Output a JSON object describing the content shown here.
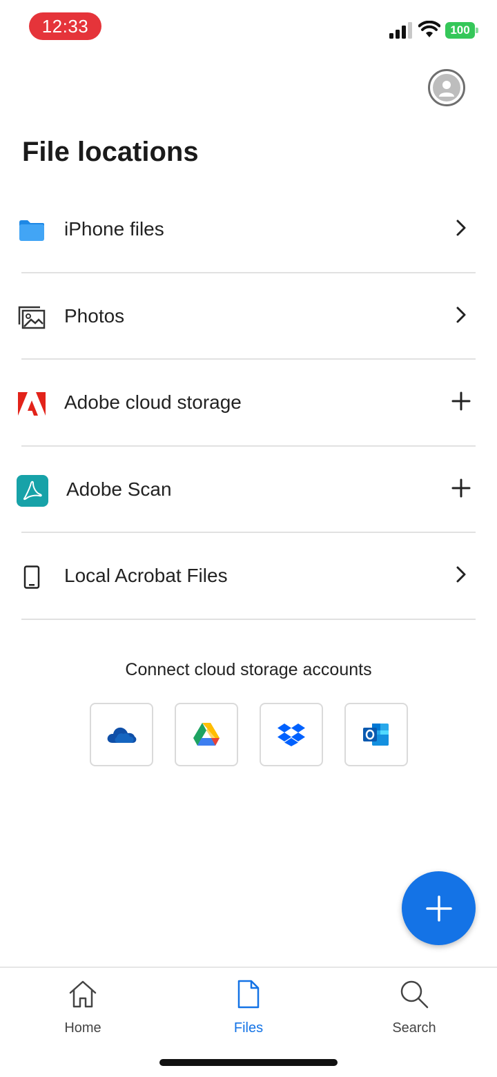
{
  "status_bar": {
    "time": "12:33",
    "battery": "100"
  },
  "page": {
    "title": "File locations"
  },
  "locations": [
    {
      "label": "iPhone files",
      "icon": "folder-icon",
      "action": "chevron-right-icon"
    },
    {
      "label": "Photos",
      "icon": "photos-icon",
      "action": "chevron-right-icon"
    },
    {
      "label": "Adobe cloud storage",
      "icon": "adobe-logo-icon",
      "action": "plus-icon"
    },
    {
      "label": "Adobe Scan",
      "icon": "adobe-scan-icon",
      "action": "plus-icon"
    },
    {
      "label": "Local Acrobat Files",
      "icon": "phone-icon",
      "action": "chevron-right-icon"
    }
  ],
  "connect": {
    "title": "Connect cloud storage accounts",
    "providers": [
      "onedrive-icon",
      "google-drive-icon",
      "dropbox-icon",
      "outlook-icon"
    ]
  },
  "bottom_nav": {
    "home": "Home",
    "files": "Files",
    "search": "Search",
    "active": "files"
  },
  "colors": {
    "accent": "#1473e6",
    "time_pill": "#e5343a",
    "battery": "#35c759",
    "adobe_red": "#e2231a",
    "scan_teal": "#17a2a8"
  }
}
